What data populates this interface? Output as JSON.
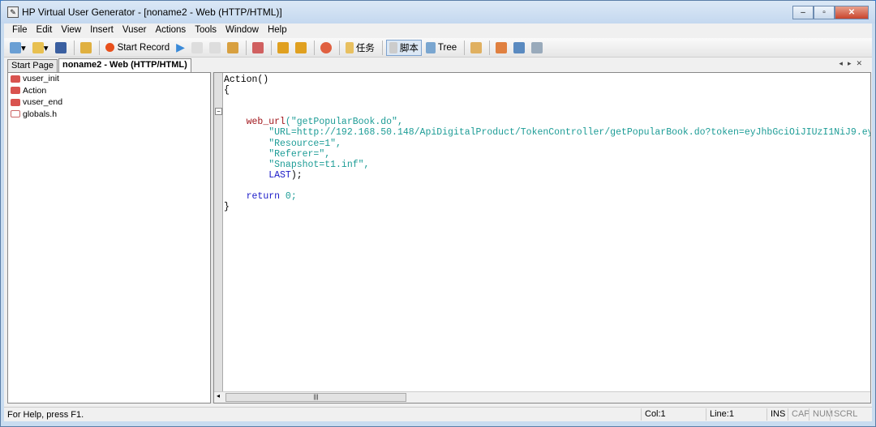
{
  "window": {
    "title": "HP Virtual User Generator - [noname2 - Web (HTTP/HTML)]"
  },
  "menu": [
    "File",
    "Edit",
    "View",
    "Insert",
    "Vuser",
    "Actions",
    "Tools",
    "Window",
    "Help"
  ],
  "toolbar": {
    "start_record": "Start Record",
    "tasks": "任务",
    "script": "脚本",
    "tree": "Tree"
  },
  "tabs": [
    "Start Page",
    "noname2 - Web (HTTP/HTML)"
  ],
  "tree": [
    "vuser_init",
    "Action",
    "vuser_end",
    "globals.h"
  ],
  "code": {
    "l1": "Action()",
    "l2": "{",
    "fn": "web_url",
    "arg0": "(\"getPopularBook.do\",",
    "url": "\"URL=http://192.168.50.148/ApiDigitalProduct/TokenController/getPopularBook.do?token=eyJhbGciOiJIUzI1NiJ9.eyJ",
    "res": "\"Resource=1\",",
    "ref": "\"Referer=\",",
    "snap": "\"Snapshot=t1.inf\",",
    "last": "LAST",
    "end": ");",
    "ret": "return",
    "zero": " 0;",
    "close": "}"
  },
  "status": {
    "help": "For Help, press F1.",
    "col": "Col:1",
    "line": "Line:1",
    "ins": "INS",
    "cap": "CAP",
    "num": "NUM",
    "scrl": "SCRL"
  }
}
